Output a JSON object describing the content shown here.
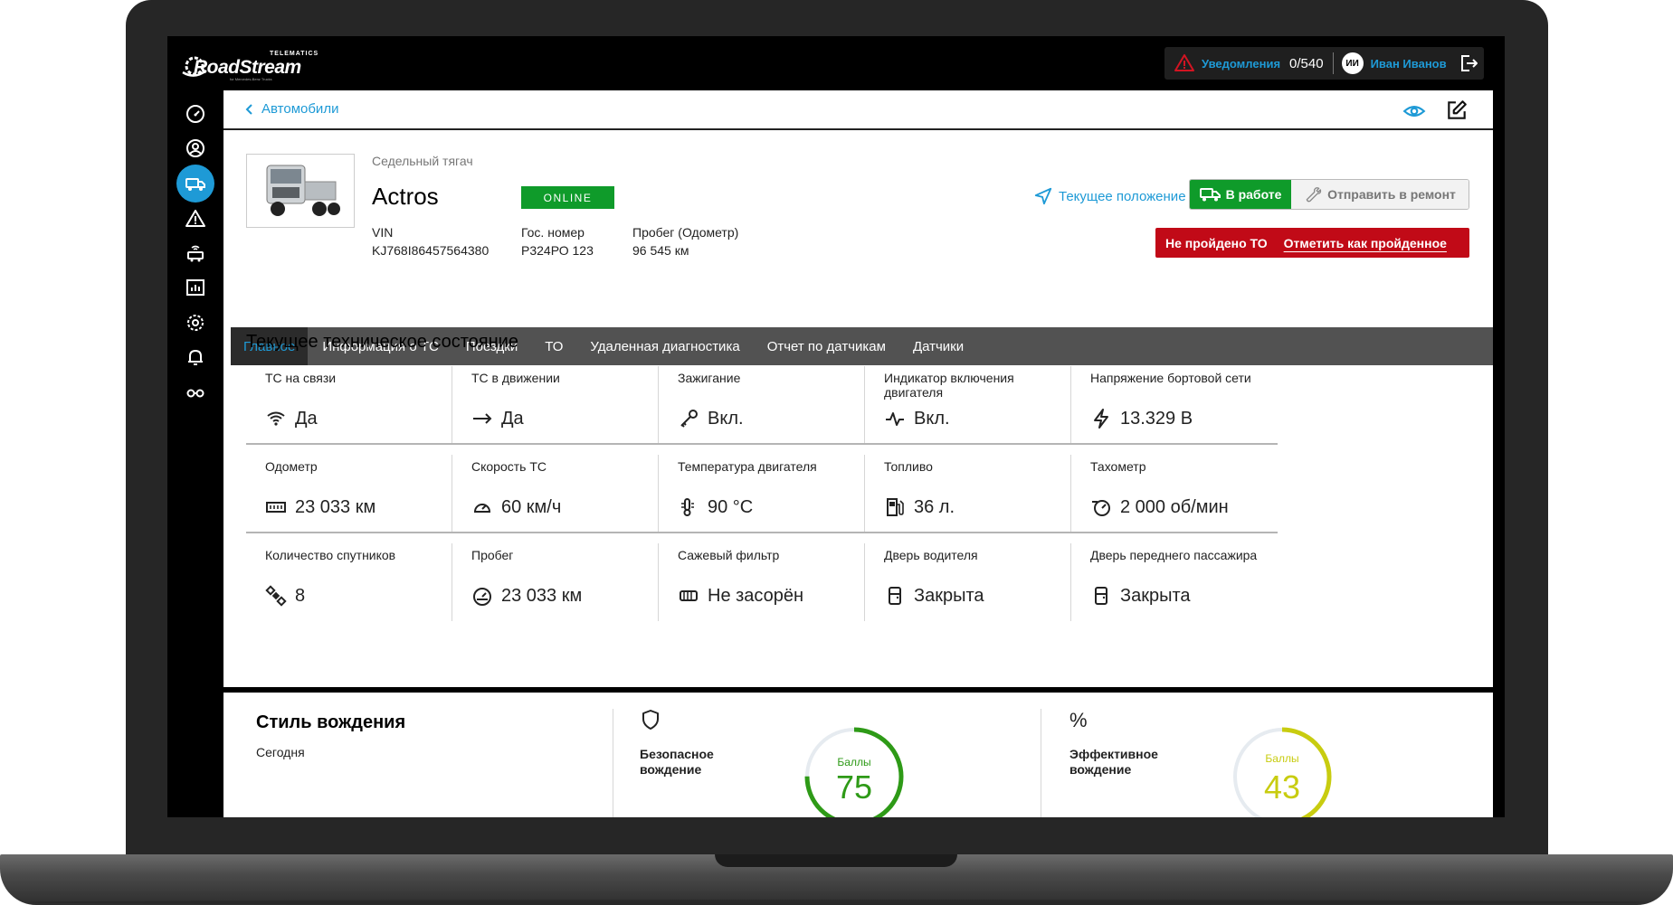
{
  "app": {
    "logo_text": "RoadStream",
    "logo_tagline": "TELEMATICS",
    "logo_sub": "for Mercedes-Benz Trucks"
  },
  "topbar": {
    "notifications_label": "Уведомления",
    "notifications_count": "0/540",
    "user_initials": "ИИ",
    "user_name": "Иван Иванов"
  },
  "sidebar": {
    "items": [
      {
        "icon": "dashboard-icon",
        "active": false
      },
      {
        "icon": "user-circle-icon",
        "active": false
      },
      {
        "icon": "truck-icon",
        "active": true
      },
      {
        "icon": "warning-icon",
        "active": false
      },
      {
        "icon": "vehicle-signal-icon",
        "active": false
      },
      {
        "icon": "chart-icon",
        "active": false
      },
      {
        "icon": "settings-icon",
        "active": false
      },
      {
        "icon": "bell-icon",
        "active": false
      },
      {
        "icon": "glasses-icon",
        "active": false
      }
    ]
  },
  "breadcrumb": {
    "back_label": "Автомобили"
  },
  "vehicle": {
    "type": "Седельный тягач",
    "model": "Actros",
    "status_badge": "ONLINE",
    "vin_label": "VIN",
    "vin": "KJ768I86457564380",
    "plate_label": "Гос. номер",
    "plate": "Р324РО 123",
    "mileage_label": "Пробег (Одометр)",
    "mileage": "96 545 км",
    "location_link": "Текущее положение",
    "status_work": "В работе",
    "status_repair": "Отправить в ремонт",
    "to_alert": "Не пройдено ТО",
    "to_action": "Отметить как пройденное"
  },
  "tabs": [
    {
      "label": "Главное",
      "active": true
    },
    {
      "label": "Информация о ТС",
      "active": false
    },
    {
      "label": "Поездки",
      "active": false
    },
    {
      "label": "ТО",
      "active": false
    },
    {
      "label": "Удаленная диагностика",
      "active": false
    },
    {
      "label": "Отчет по датчикам",
      "active": false
    },
    {
      "label": "Датчики",
      "active": false
    }
  ],
  "tech_state": {
    "title": "Текущее техническое состояние",
    "cells": [
      {
        "label": "ТС на связи",
        "value": "Да",
        "icon": "wifi-icon"
      },
      {
        "label": "ТС в движении",
        "value": "Да",
        "icon": "arrow-right-icon"
      },
      {
        "label": "Зажигание",
        "value": "Вкл.",
        "icon": "key-icon"
      },
      {
        "label": "Индикатор включения двигателя",
        "value": "Вкл.",
        "icon": "pulse-icon"
      },
      {
        "label": "Напряжение бортовой сети",
        "value": "13.329 В",
        "icon": "lightning-icon"
      },
      {
        "label": "Одометр",
        "value": "23 033 км",
        "icon": "odometer-icon"
      },
      {
        "label": "Скорость ТС",
        "value": "60 км/ч",
        "icon": "speedometer-icon"
      },
      {
        "label": "Температура двигателя",
        "value": "90 °С",
        "icon": "engine-temp-icon"
      },
      {
        "label": "Топливо",
        "value": "36 л.",
        "icon": "fuel-icon"
      },
      {
        "label": "Тахометр",
        "value": "2 000 об/мин",
        "icon": "tachometer-icon"
      },
      {
        "label": "Количество спутников",
        "value": "8",
        "icon": "satellite-icon"
      },
      {
        "label": "Пробег",
        "value": "23 033 км",
        "icon": "mileage-gauge-icon"
      },
      {
        "label": "Сажевый фильтр",
        "value": "Не засорён",
        "icon": "filter-icon"
      },
      {
        "label": "Дверь водителя",
        "value": "Закрыта",
        "icon": "door-icon"
      },
      {
        "label": "Дверь переднего пассажира",
        "value": "Закрыта",
        "icon": "door-icon"
      }
    ]
  },
  "driving_style": {
    "title": "Стиль вождения",
    "period": "Сегодня",
    "scores": [
      {
        "label_line1": "Безопасное",
        "label_line2": "вождение",
        "caption": "Баллы",
        "value": "75",
        "percent": 75,
        "color": "#2e9a17",
        "icon": "shield-icon"
      },
      {
        "label_line1": "Эффективное",
        "label_line2": "вождение",
        "caption": "Баллы",
        "value": "43",
        "percent": 43,
        "color": "#c8cc10",
        "icon": "percent-icon"
      }
    ]
  }
}
